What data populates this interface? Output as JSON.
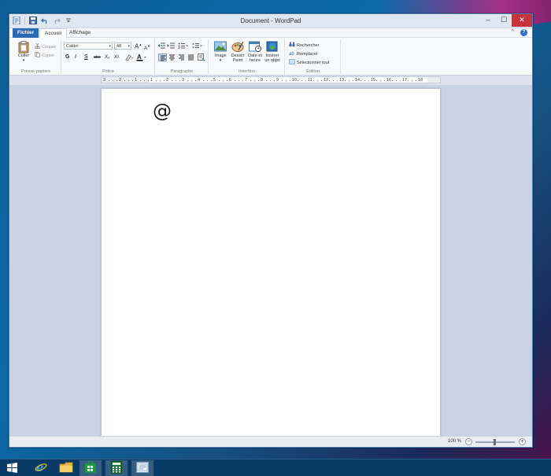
{
  "window": {
    "title": "Document - WordPad",
    "controls": {
      "minimize": "–",
      "maximize": "☐",
      "close": "✕"
    }
  },
  "tabs": {
    "file": "Fichier",
    "home": "Accueil",
    "view": "Affichage",
    "collapse": "^",
    "help": "?"
  },
  "ribbon": {
    "clipboard": {
      "paste": "Coller",
      "cut": "Couper",
      "copy": "Copier",
      "label": "Presse-papiers"
    },
    "font": {
      "family": "Calibri",
      "size": "48",
      "grow": "A",
      "shrink": "A",
      "bold": "G",
      "italic": "I",
      "underline": "S",
      "strike": "abc",
      "subscript": "X₂",
      "superscript": "X²",
      "label": "Police"
    },
    "paragraph": {
      "label": "Paragraphe"
    },
    "insert": {
      "image": "Image",
      "paint_line1": "Dessin",
      "paint_line2": "Paint",
      "date_line1": "Date et",
      "date_line2": "heure",
      "object_line1": "Insérer",
      "object_line2": "un objet",
      "label": "Insertion"
    },
    "editing": {
      "find": "Rechercher",
      "replace": "Remplacer",
      "select_all": "Sélectionner tout",
      "label": "Édition"
    }
  },
  "ruler": {
    "numbers": [
      "3",
      "2",
      "1",
      "1",
      "2",
      "3",
      "4",
      "5",
      "6",
      "7",
      "8",
      "9",
      "10",
      "11",
      "12",
      "13",
      "14",
      "15",
      "16",
      "17",
      "18"
    ]
  },
  "document": {
    "text": "@"
  },
  "status": {
    "zoom": "100 %",
    "zoom_out": "−",
    "zoom_in": "+"
  },
  "taskbar": {
    "items": [
      "windows-start",
      "internet-explorer",
      "file-explorer",
      "store",
      "calculator",
      "wordpad"
    ]
  },
  "colors": {
    "accent": "#2a6ab4",
    "close": "#c7333a",
    "taskbar": "#0a3b66"
  }
}
